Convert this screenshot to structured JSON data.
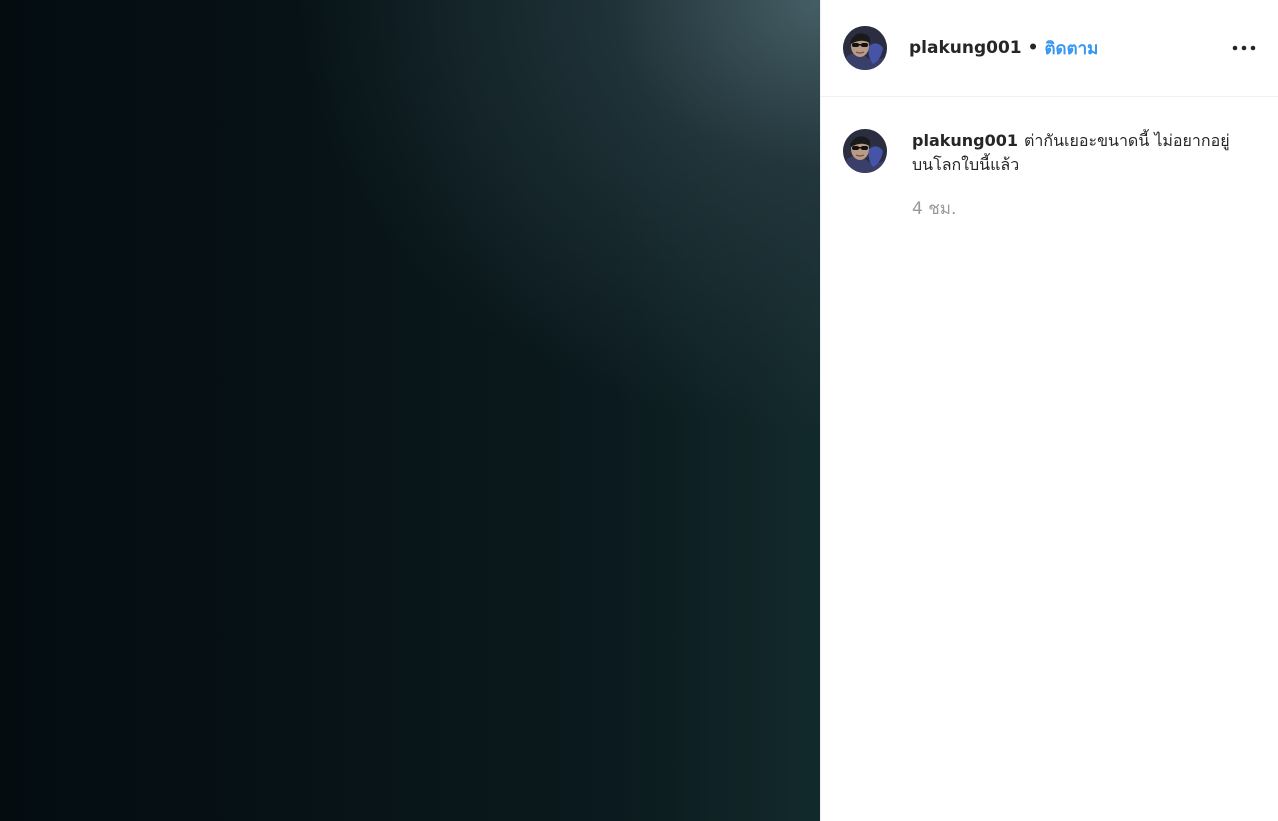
{
  "post": {
    "header": {
      "username": "plakung001",
      "separator": "•",
      "follow_label": "ติดตาม",
      "more_icon": "more-options-icon"
    },
    "caption": {
      "username": "plakung001",
      "text": "ต่ากันเยอะขนาดนี้ ไม่อยากอยู่บนโลกใบนี้แล้ว",
      "timestamp": "4 ชม."
    }
  },
  "colors": {
    "link_blue": "#3897f0",
    "text_dark": "#262626",
    "text_muted": "#999999",
    "divider": "#efefef"
  }
}
